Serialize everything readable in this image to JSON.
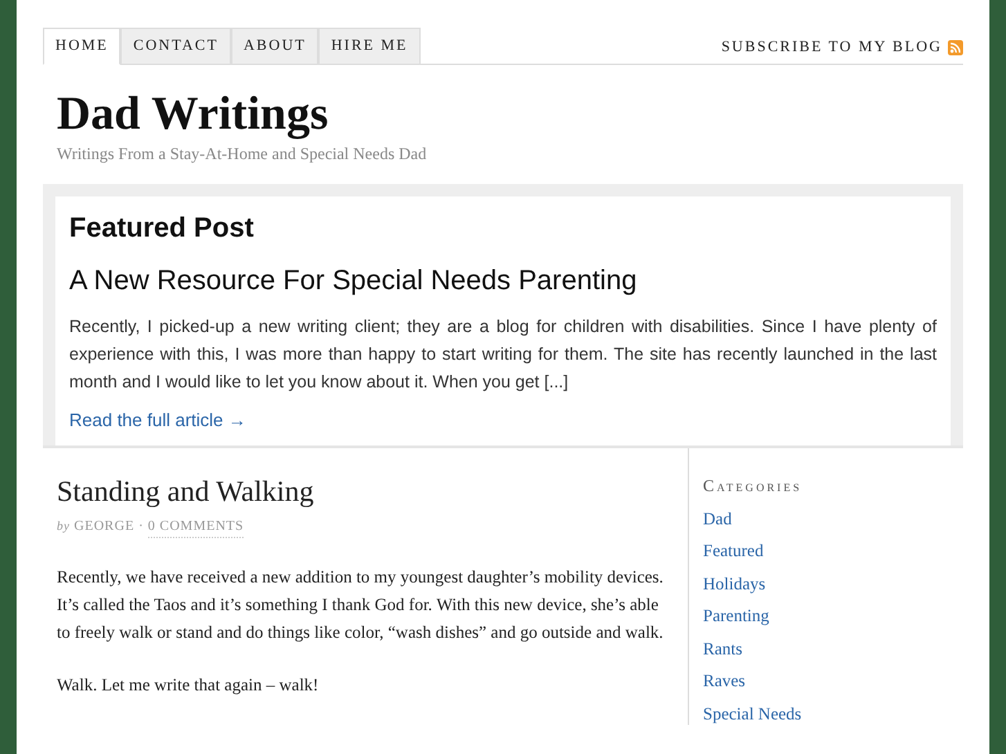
{
  "nav": {
    "tabs": [
      {
        "label": "HOME",
        "selected": true
      },
      {
        "label": "CONTACT",
        "selected": false
      },
      {
        "label": "ABOUT",
        "selected": false
      },
      {
        "label": "HIRE ME",
        "selected": false
      }
    ],
    "subscribe": "SUBSCRIBE TO MY BLOG"
  },
  "header": {
    "title": "Dad Writings",
    "tagline": "Writings From a Stay-At-Home and Special Needs Dad"
  },
  "featured": {
    "heading": "Featured Post",
    "title": "A New Resource For Special Needs Parenting",
    "excerpt": "Recently, I picked-up a new writing client; they are a blog for children with disabilities. Since I have plenty of experience with this, I was more than happy to start writing for them. The site has recently launched in the last month and I would like to let you know about it. When you get [...]",
    "link": "Read the full article →"
  },
  "post": {
    "title": "Standing and Walking",
    "by": "by",
    "author": "GEORGE",
    "separator": "·",
    "comments": "0 COMMENTS",
    "paragraphs": [
      "Recently, we have received a new addition to my youngest daughter’s mobility devices. It’s called the Taos and it’s something I thank God for. With this new device, she’s able to freely walk or stand and do things like color, “wash dishes” and go outside and walk.",
      "Walk. Let me write that again – walk!"
    ]
  },
  "sidebar": {
    "heading": "Categories",
    "items": [
      "Dad",
      "Featured",
      "Holidays",
      "Parenting",
      "Rants",
      "Raves",
      "Special Needs"
    ]
  }
}
